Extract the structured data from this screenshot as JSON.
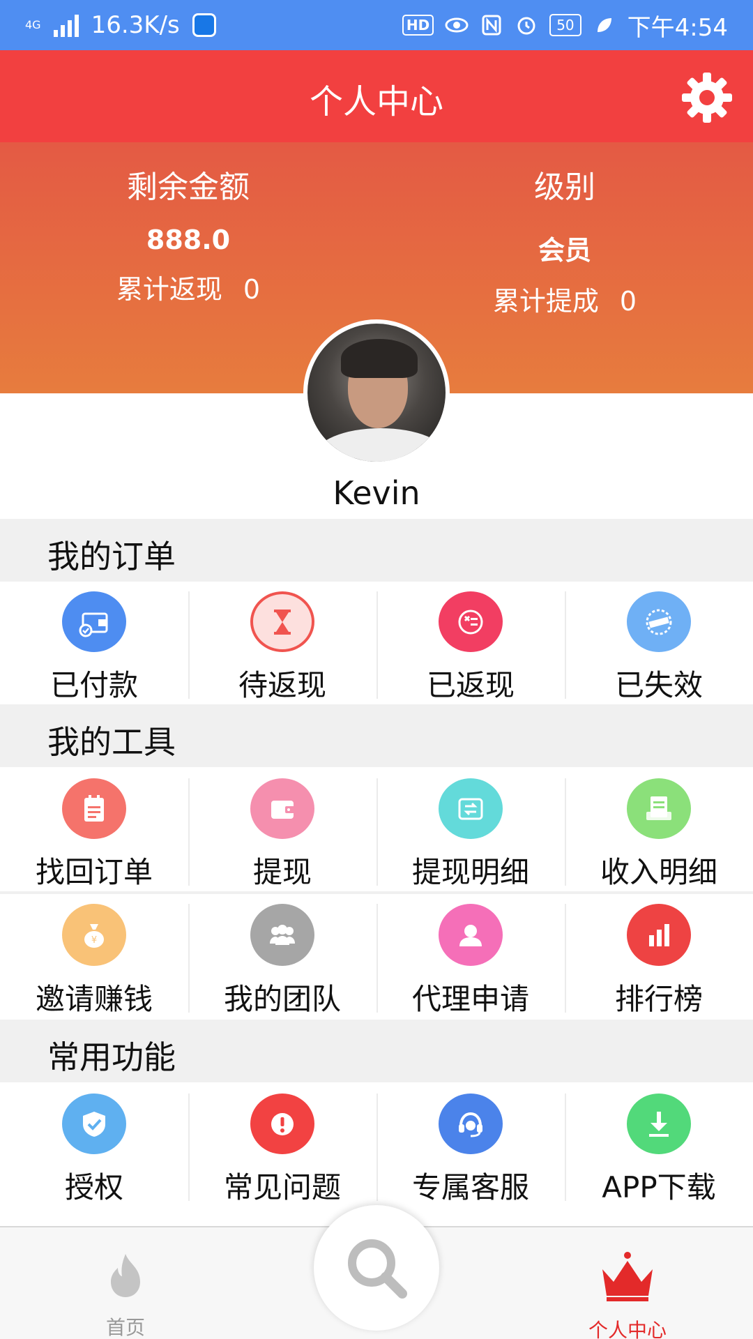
{
  "status_bar": {
    "network": "4G",
    "speed": "16.3K/s",
    "battery": "50",
    "time": "下午4:54",
    "hd": "HD"
  },
  "header": {
    "title": "个人中心"
  },
  "account": {
    "balance_label": "剩余金额",
    "balance_value": "888.0",
    "cashback_label": "累计返现",
    "cashback_value": "0",
    "level_label": "级别",
    "level_value": "会员",
    "commission_label": "累计提成",
    "commission_value": "0"
  },
  "user": {
    "name": "Kevin"
  },
  "sections": {
    "orders": {
      "title": "我的订单",
      "items": [
        {
          "label": "已付款",
          "icon": "wallet-check-icon",
          "color": "#4e8df1"
        },
        {
          "label": "待返现",
          "icon": "hourglass-icon",
          "color": "#f0544f"
        },
        {
          "label": "已返现",
          "icon": "return-icon",
          "color": "#f23e62"
        },
        {
          "label": "已失效",
          "icon": "expired-stamp-icon",
          "color": "#6fb0f5"
        }
      ]
    },
    "tools": {
      "title": "我的工具",
      "items": [
        {
          "label": "找回订单",
          "icon": "clipboard-icon",
          "color": "#f5736b"
        },
        {
          "label": "提现",
          "icon": "wallet-icon",
          "color": "#f58fae"
        },
        {
          "label": "提现明细",
          "icon": "transfer-icon",
          "color": "#63dada"
        },
        {
          "label": "收入明细",
          "icon": "receipt-icon",
          "color": "#8be07a"
        },
        {
          "label": "邀请赚钱",
          "icon": "money-bag-icon",
          "color": "#f9c277"
        },
        {
          "label": "我的团队",
          "icon": "team-icon",
          "color": "#a6a6a6"
        },
        {
          "label": "代理申请",
          "icon": "person-icon",
          "color": "#f56fb8"
        },
        {
          "label": "排行榜",
          "icon": "bar-chart-icon",
          "color": "#ee4343"
        }
      ]
    },
    "common": {
      "title": "常用功能",
      "items": [
        {
          "label": "授权",
          "icon": "shield-check-icon",
          "color": "#5fb0f0"
        },
        {
          "label": "常见问题",
          "icon": "exclamation-icon",
          "color": "#f24242"
        },
        {
          "label": "专属客服",
          "icon": "headset-icon",
          "color": "#4b83ea"
        },
        {
          "label": "APP下载",
          "icon": "download-icon",
          "color": "#52d97a"
        }
      ]
    }
  },
  "bottom_nav": {
    "home_label": "首页",
    "me_label": "个人中心",
    "active_color": "#e32a2a",
    "inactive_color": "#999999"
  }
}
